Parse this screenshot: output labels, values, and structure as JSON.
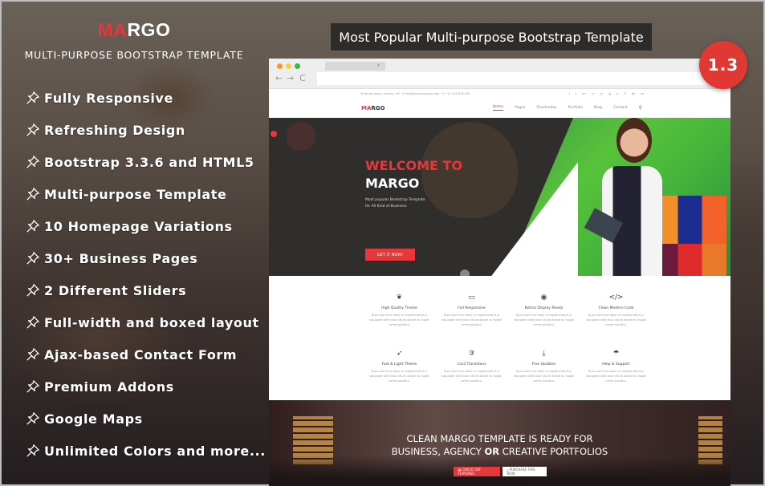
{
  "brand": {
    "logo_accent": "MA",
    "logo_rest": "RGO",
    "tagline": "MULTI-PURPOSE BOOTSTRAP TEMPLATE"
  },
  "features": [
    "Fully Responsive",
    "Refreshing Design",
    "Bootstrap 3.3.6 and HTML5",
    "Multi-purpose Template",
    "10 Homepage Variations",
    "30+ Business Pages",
    "2 Different Sliders",
    "Full-width and boxed layout",
    "Ajax-based Contact Form",
    "Premium Addons",
    "Google Maps",
    "Unlimited Colors and more..."
  ],
  "banner": {
    "title": "Most Popular Multi-purpose Bootstrap Template"
  },
  "version_badge": "1.3",
  "browser": {
    "controls": {
      "back": "←",
      "forward": "→",
      "reload": "C"
    },
    "tab_close": "×"
  },
  "site": {
    "topbar_contact": "Ⓜ House name, London, UK  ·  ✉ info@yourcompany.com  ·  ✆ +12 345 678 000",
    "social_icons": [
      "f",
      "t",
      "g+",
      "in",
      "yt",
      "ig",
      "p",
      "fl",
      "db",
      "sk"
    ],
    "logo_accent": "MA",
    "logo_rest": "RGO",
    "menu": [
      "Home",
      "Pages",
      "Shortcodes",
      "Portfolio",
      "Blog",
      "Contact"
    ],
    "menu_active_index": 0,
    "search_icon": "⚲"
  },
  "hero": {
    "welcome": "WELCOME TO",
    "name": "MARGO",
    "subtitle_line1": "Most popular Bootstrap Template",
    "subtitle_line2": "for All Kind of Business",
    "cta": "GET IT NOW!"
  },
  "services": [
    {
      "icon": "leaf-icon",
      "glyph": "❦",
      "title": "High Quality Theme",
      "desc": "Duis aute irure dolor in reprehenderit in voluptate velit esse cillum dolore eu fugiat Lorem pariatur."
    },
    {
      "icon": "monitor-icon",
      "glyph": "▭",
      "title": "Full Responsive",
      "desc": "Duis aute irure dolor in reprehenderit in voluptate velit esse cillum dolore eu fugiat Lorem pariatur."
    },
    {
      "icon": "eye-icon",
      "glyph": "◉",
      "title": "Retina Display Ready",
      "desc": "Duis aute irure dolor in reprehenderit in voluptate velit esse cillum dolore eu fugiat Lorem pariatur."
    },
    {
      "icon": "code-icon",
      "glyph": "</>",
      "title": "Clean Modern Code",
      "desc": "Duis aute irure dolor in reprehenderit in voluptate velit esse cillum dolore eu fugiat Lorem pariatur."
    },
    {
      "icon": "rocket-icon",
      "glyph": "➶",
      "title": "Fast & Light Theme",
      "desc": "Duis aute irure dolor in reprehenderit in voluptate velit esse cillum dolore eu fugiat Lorem pariatur."
    },
    {
      "icon": "css3-icon",
      "glyph": "③",
      "title": "Css3 Transitions",
      "desc": "Duis aute irure dolor in reprehenderit in voluptate velit esse cillum dolore eu fugiat Lorem pariatur."
    },
    {
      "icon": "download-icon",
      "glyph": "⤓",
      "title": "Free Updates",
      "desc": "Duis aute irure dolor in reprehenderit in voluptate velit esse cillum dolore eu fugiat Lorem pariatur."
    },
    {
      "icon": "umbrella-icon",
      "glyph": "☂",
      "title": "Help & Support",
      "desc": "Duis aute irure dolor in reprehenderit in voluptate velit esse cillum dolore eu fugiat Lorem pariatur."
    }
  ],
  "cta_section": {
    "line1": "CLEAN MARGO TEMPLATE IS READY FOR",
    "line2_a": "BUSINESS, AGENCY ",
    "line2_b": "OR",
    "line2_c": " CREATIVE PORTFOLIOS",
    "primary_button": "▦ CHECK OUT FEATURES",
    "secondary_button": "⤓ PURCHASE THIS NOW"
  },
  "colors": {
    "accent": "#e8373a",
    "badge": "#e03832",
    "banner_bg": "#2e2b29"
  }
}
